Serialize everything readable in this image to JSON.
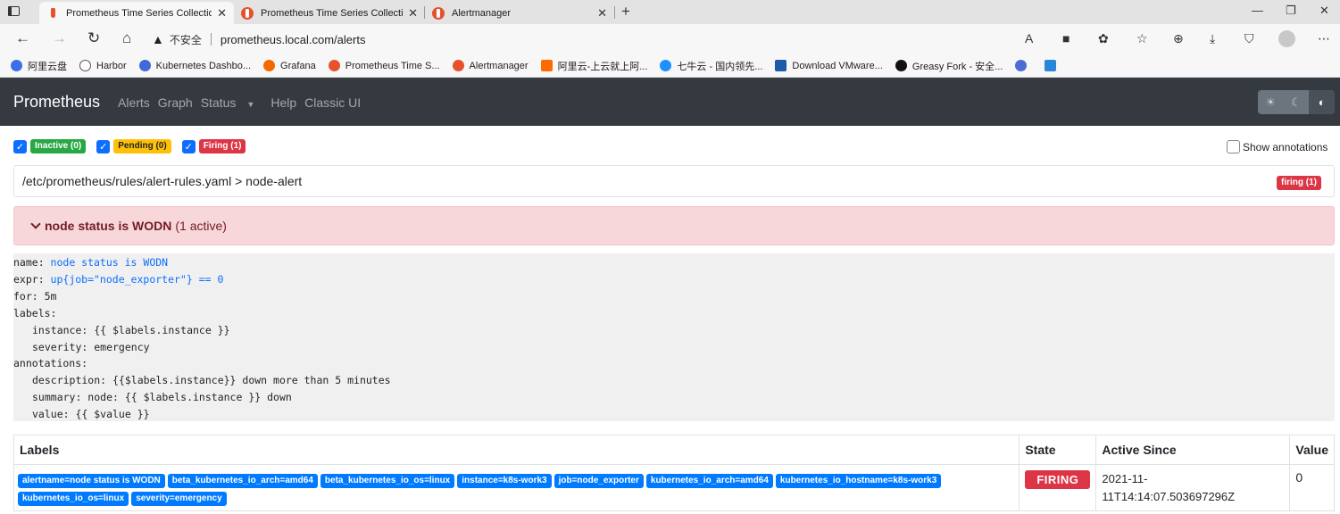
{
  "browser": {
    "tabs": [
      {
        "title": "Prometheus Time Series Collectio",
        "active": true
      },
      {
        "title": "Prometheus Time Series Collectio",
        "active": false
      },
      {
        "title": "Alertmanager",
        "active": false
      }
    ],
    "address": {
      "security": "不安全",
      "url": "prometheus.local.com/alerts"
    },
    "bookmarks": [
      "阿里云盘",
      "Harbor",
      "Kubernetes Dashbo...",
      "Grafana",
      "Prometheus Time S...",
      "Alertmanager",
      "阿里云-上云就上阿...",
      "七牛云 - 国内领先...",
      "Download VMware...",
      "Greasy Fork - 安全..."
    ]
  },
  "navbar": {
    "brand": "Prometheus",
    "links": [
      "Alerts",
      "Graph",
      "Status",
      "Help",
      "Classic UI"
    ]
  },
  "filters": {
    "inactive": "Inactive (0)",
    "pending": "Pending (0)",
    "firing": "Firing (1)",
    "show_annotations": "Show annotations"
  },
  "group": {
    "path": "/etc/prometheus/rules/alert-rules.yaml > node-alert",
    "badge": "firing (1)"
  },
  "alert": {
    "name": "node status is WODN",
    "active": "(1 active)"
  },
  "rule": {
    "name_key": "name: ",
    "name_val": "node status is WODN",
    "expr_key": "expr: ",
    "expr_val": "up{job=\"node_exporter\"} == 0",
    "for": "for: 5m",
    "labels_key": "labels:",
    "label_instance": "instance: {{ $labels.instance }}",
    "label_severity": "severity: emergency",
    "annotations_key": "annotations:",
    "ann_description": "description: {{$labels.instance}} down more than 5 minutes",
    "ann_summary": "summary: node: {{ $labels.instance }} down",
    "ann_value": "value: {{ $value }}"
  },
  "table": {
    "headers": {
      "labels": "Labels",
      "state": "State",
      "active_since": "Active Since",
      "value": "Value"
    },
    "row": {
      "labels": [
        "alertname=node status is WODN",
        "beta_kubernetes_io_arch=amd64",
        "beta_kubernetes_io_os=linux",
        "instance=k8s-work3",
        "job=node_exporter",
        "kubernetes_io_arch=amd64",
        "kubernetes_io_hostname=k8s-work3",
        "kubernetes_io_os=linux",
        "severity=emergency"
      ],
      "state": "FIRING",
      "active_since_1": "2021-11-",
      "active_since_2": "11T14:14:07.503697296Z",
      "value": "0"
    }
  },
  "colors": {
    "firing": "#dc3545",
    "pending": "#ffc107",
    "inactive": "#28a745",
    "label": "#007bff",
    "navbar": "#343a40"
  }
}
